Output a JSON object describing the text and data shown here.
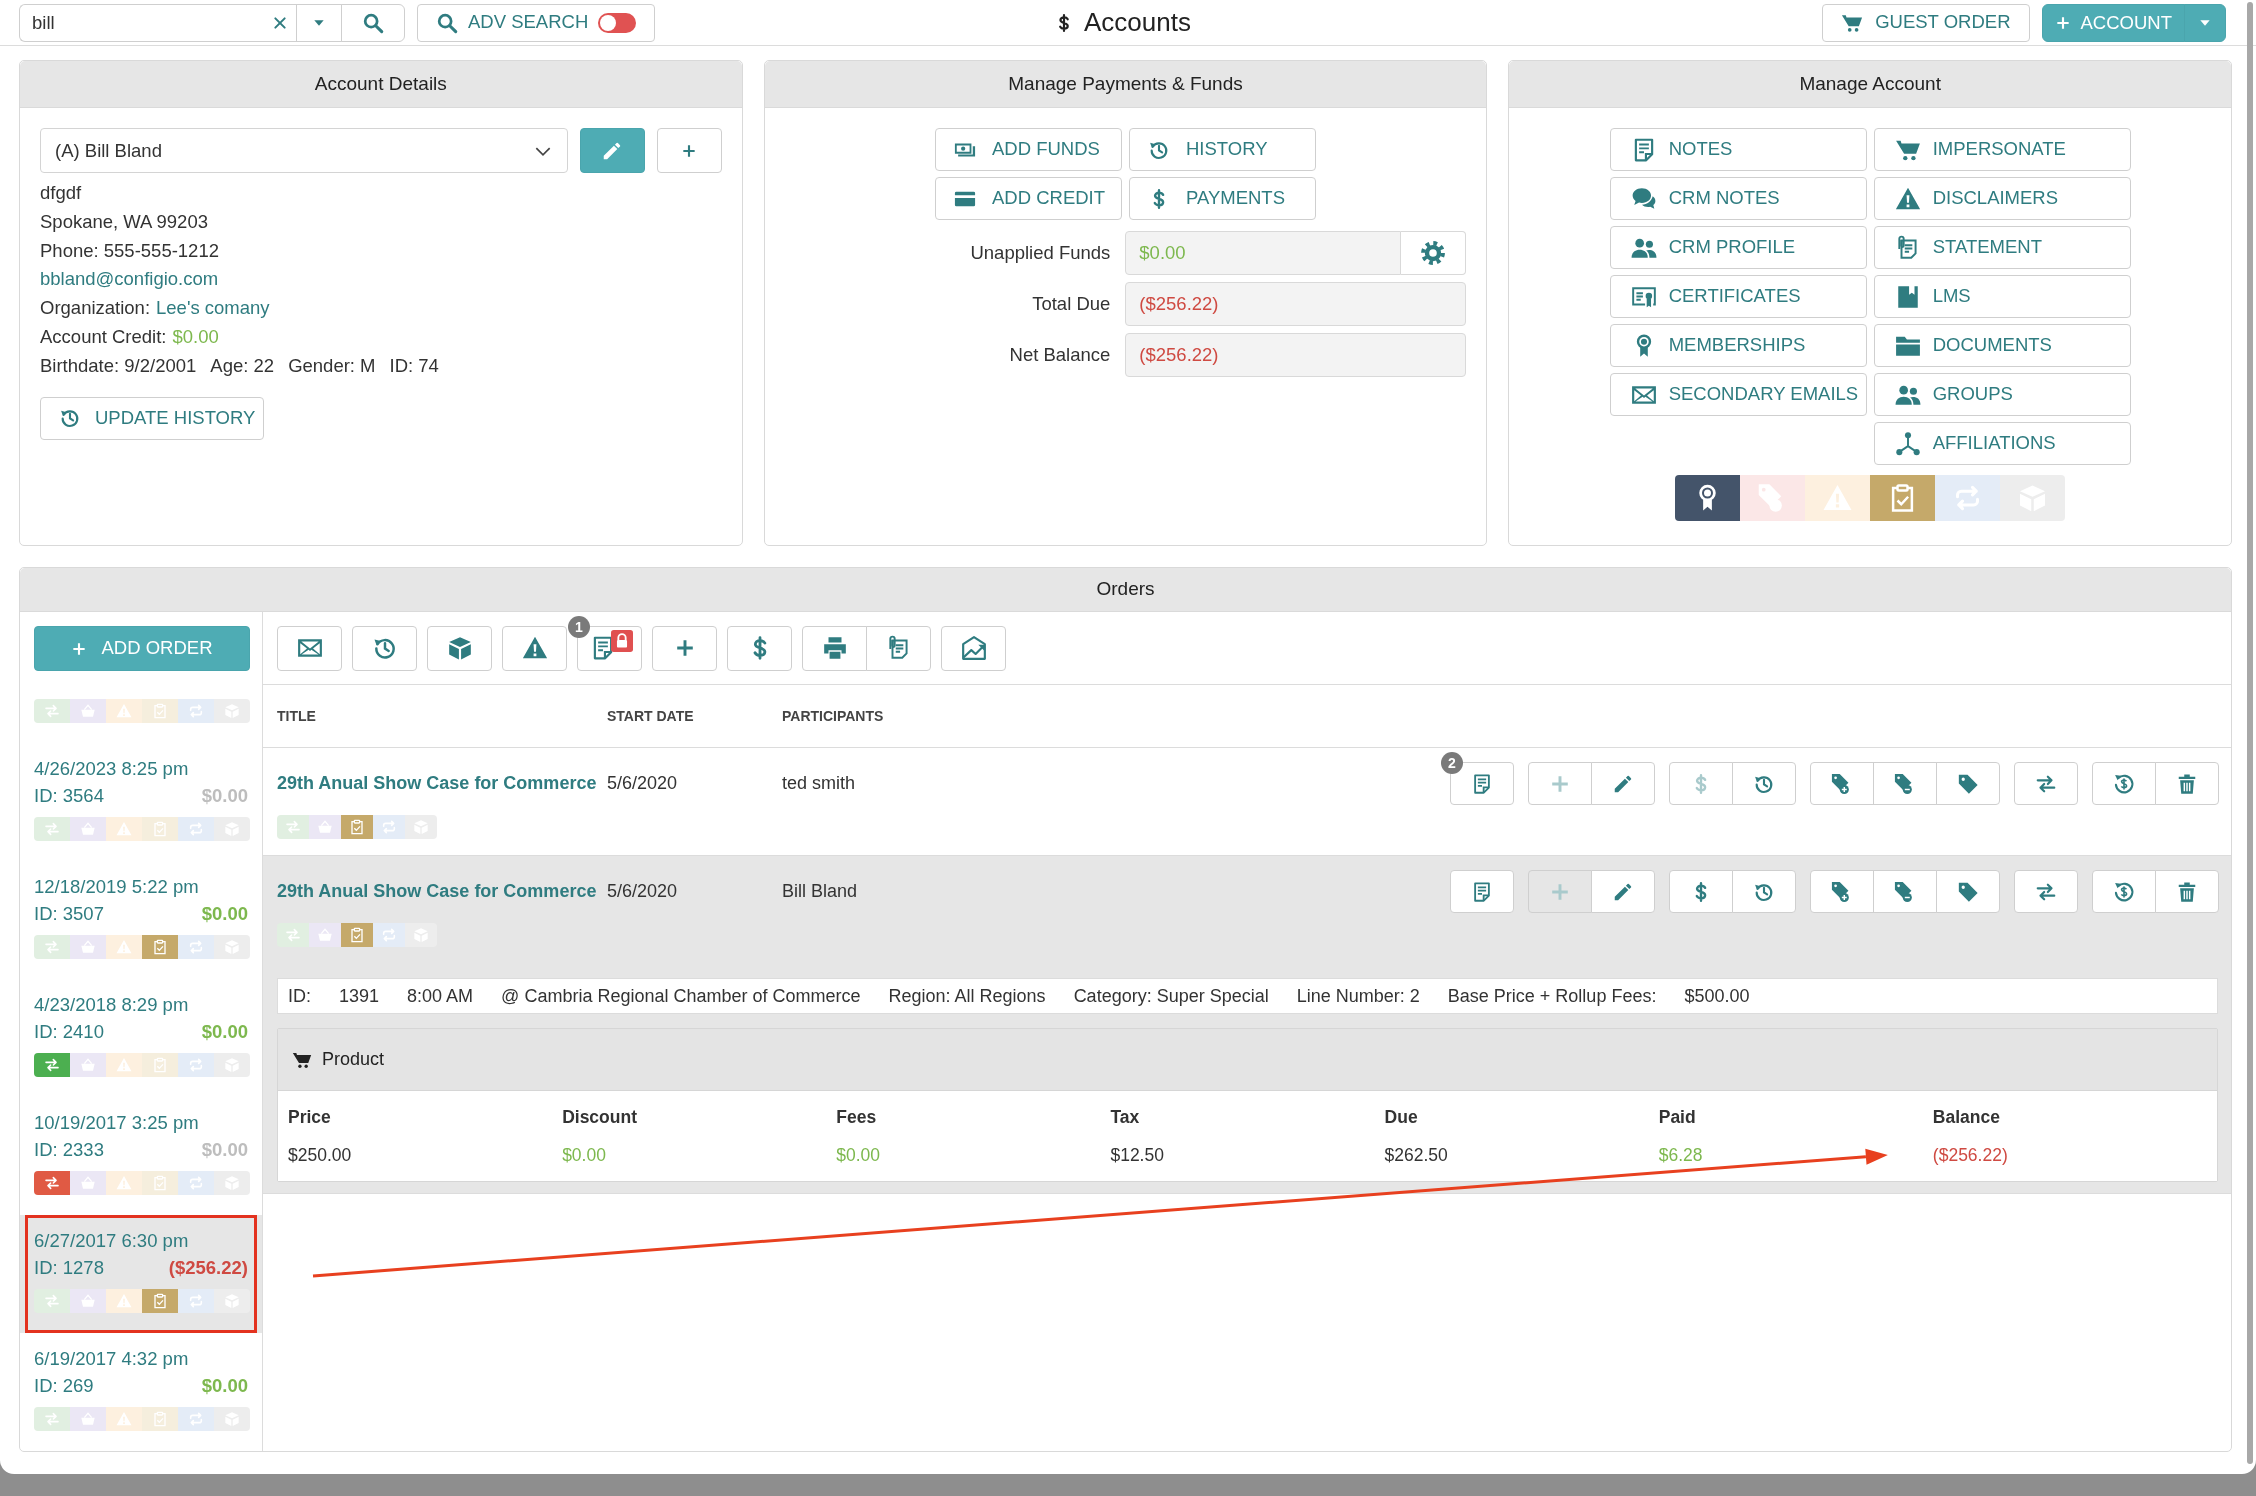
{
  "top_bar": {
    "search_value": "bill",
    "adv_search": {
      "label": "ADV SEARCH",
      "on": false
    },
    "title": "Accounts",
    "guest_order": "GUEST ORDER",
    "new_account": "ACCOUNT"
  },
  "account_details": {
    "title": "Account Details",
    "account": "(A) Bill Bland",
    "lines": [
      {
        "kind": "text",
        "text": "dfgdf"
      },
      {
        "kind": "text",
        "text": "Spokane, WA 99203"
      },
      {
        "kind": "text",
        "text": "Phone: 555-555-1212"
      },
      {
        "kind": "link",
        "text": "bbland@configio.com"
      },
      {
        "kind": "labeled_link",
        "label": "Organization:",
        "value": "Lee's comany"
      },
      {
        "kind": "labeled_amount",
        "label": "Account Credit:",
        "value": "$0.00",
        "color": "#7db84e"
      },
      {
        "kind": "facts",
        "items": [
          "Birthdate: 9/2/2001",
          "Age: 22",
          "Gender: M",
          "ID: 74"
        ]
      }
    ],
    "update_history": "UPDATE HISTORY"
  },
  "payments": {
    "title": "Manage Payments & Funds",
    "buttons": [
      "ADD FUNDS",
      "HISTORY",
      "ADD CREDIT",
      "PAYMENTS"
    ],
    "fields": [
      {
        "kind": "action",
        "label": "Unapplied Funds",
        "value": "$0.00",
        "color": "#7db84e"
      },
      {
        "kind": "plain",
        "label": "Total Due",
        "value": "($256.22)",
        "color": "#cf4a42"
      },
      {
        "kind": "plain",
        "label": "Net Balance",
        "value": "($256.22)",
        "color": "#cf4a42"
      }
    ]
  },
  "manage_account": {
    "title": "Manage Account",
    "columns": [
      [
        "NOTES",
        "CRM NOTES",
        "CRM PROFILE",
        "CERTIFICATES",
        "MEMBERSHIPS",
        "SECONDARY EMAILS"
      ],
      [
        "IMPERSONATE",
        "DISCLAIMERS",
        "STATEMENT",
        "LMS",
        "DOCUMENTS",
        "GROUPS",
        "AFFILIATIONS"
      ]
    ],
    "status_tiles": [
      {
        "active": true,
        "color": "#44546a"
      },
      {
        "active": false
      },
      {
        "active": false
      },
      {
        "active": true,
        "color": "#c5a96a"
      },
      {
        "active": false
      },
      {
        "active": false
      }
    ]
  },
  "orders": {
    "title": "Orders",
    "add_order": "ADD ORDER",
    "toolbar_badge": "1",
    "list": [
      {
        "selected": false,
        "highlighted": false,
        "icons": [
          {
            "active": false
          },
          {
            "active": false
          },
          {
            "active": false
          },
          {
            "active": false
          },
          {
            "active": false
          },
          {
            "active": false
          }
        ]
      },
      {
        "date": "4/26/2023 8:25 pm",
        "id": "ID: 3564",
        "amount": "$0.00",
        "color": "#bdbdbd",
        "selected": false,
        "highlighted": false,
        "icons": [
          {
            "active": false
          },
          {
            "active": false
          },
          {
            "active": false
          },
          {
            "active": false
          },
          {
            "active": false
          },
          {
            "active": false
          }
        ]
      },
      {
        "date": "12/18/2019 5:22 pm",
        "id": "ID: 3507",
        "amount": "$0.00",
        "color": "#7db84e",
        "selected": false,
        "highlighted": false,
        "icons": [
          {
            "active": false
          },
          {
            "active": false
          },
          {
            "active": false
          },
          {
            "active": true,
            "color": "#c5a96a"
          },
          {
            "active": false
          },
          {
            "active": false
          }
        ]
      },
      {
        "date": "4/23/2018 8:29 pm",
        "id": "ID: 2410",
        "amount": "$0.00",
        "color": "#7db84e",
        "selected": false,
        "highlighted": false,
        "icons": [
          {
            "active": true,
            "color": "#4caf50"
          },
          {
            "active": false
          },
          {
            "active": false
          },
          {
            "active": false
          },
          {
            "active": false
          },
          {
            "active": false
          }
        ]
      },
      {
        "date": "10/19/2017 3:25 pm",
        "id": "ID: 2333",
        "amount": "$0.00",
        "color": "#bdbdbd",
        "selected": false,
        "highlighted": false,
        "icons": [
          {
            "active": true,
            "color": "#e05a44"
          },
          {
            "active": false
          },
          {
            "active": false
          },
          {
            "active": false
          },
          {
            "active": false
          },
          {
            "active": false
          }
        ]
      },
      {
        "date": "6/27/2017 6:30 pm",
        "id": "ID: 1278",
        "amount": "($256.22)",
        "color": "#cf4a42",
        "selected": true,
        "highlighted": true,
        "icons": [
          {
            "active": false
          },
          {
            "active": false
          },
          {
            "active": false
          },
          {
            "active": true,
            "color": "#c5a96a"
          },
          {
            "active": false
          },
          {
            "active": false
          }
        ]
      },
      {
        "date": "6/19/2017 4:32 pm",
        "id": "ID: 269",
        "amount": "$0.00",
        "color": "#7db84e",
        "selected": false,
        "highlighted": false,
        "icons": [
          {
            "active": false
          },
          {
            "active": false
          },
          {
            "active": false
          },
          {
            "active": false
          },
          {
            "active": false
          },
          {
            "active": false
          }
        ]
      }
    ],
    "table": {
      "columns": [
        "TITLE",
        "START DATE",
        "PARTICIPANTS"
      ],
      "rows": [
        {
          "title": "29th Anual Show Case for Commerce",
          "start_date": "5/6/2020",
          "participants": "ted smith",
          "selected": false,
          "notes_badge": "2",
          "add_disabled": true,
          "payment_disabled": true,
          "icons": [
            {
              "active": false
            },
            {
              "active": false
            },
            {
              "active": true,
              "color": "#c5a96a"
            },
            {
              "active": false
            },
            {
              "active": false
            }
          ]
        },
        {
          "title": "29th Anual Show Case for Commerce",
          "start_date": "5/6/2020",
          "participants": "Bill Bland",
          "selected": true,
          "add_disabled": true,
          "payment_disabled": false,
          "icons": [
            {
              "active": false
            },
            {
              "active": false
            },
            {
              "active": true,
              "color": "#c5a96a"
            },
            {
              "active": false
            },
            {
              "active": false
            }
          ],
          "details": {
            "info": [
              "ID:",
              "1391",
              "8:00 AM",
              "@ Cambria Regional Chamber of Commerce",
              "Region: All Regions",
              "Category: Super Special",
              "Line Number: 2",
              "Base Price + Rollup Fees:",
              "$500.00"
            ],
            "product": {
              "title": "Product",
              "columns": [
                {
                  "label": "Price",
                  "value": "$250.00",
                  "color": "#333333"
                },
                {
                  "label": "Discount",
                  "value": "$0.00",
                  "color": "#7db84e"
                },
                {
                  "label": "Fees",
                  "value": "$0.00",
                  "color": "#7db84e"
                },
                {
                  "label": "Tax",
                  "value": "$12.50",
                  "color": "#333333"
                },
                {
                  "label": "Due",
                  "value": "$262.50",
                  "color": "#333333"
                },
                {
                  "label": "Paid",
                  "value": "$6.28",
                  "color": "#7db84e"
                },
                {
                  "label": "Balance",
                  "value": "($256.22)",
                  "color": "#cf4a42"
                }
              ]
            }
          }
        }
      ]
    }
  }
}
